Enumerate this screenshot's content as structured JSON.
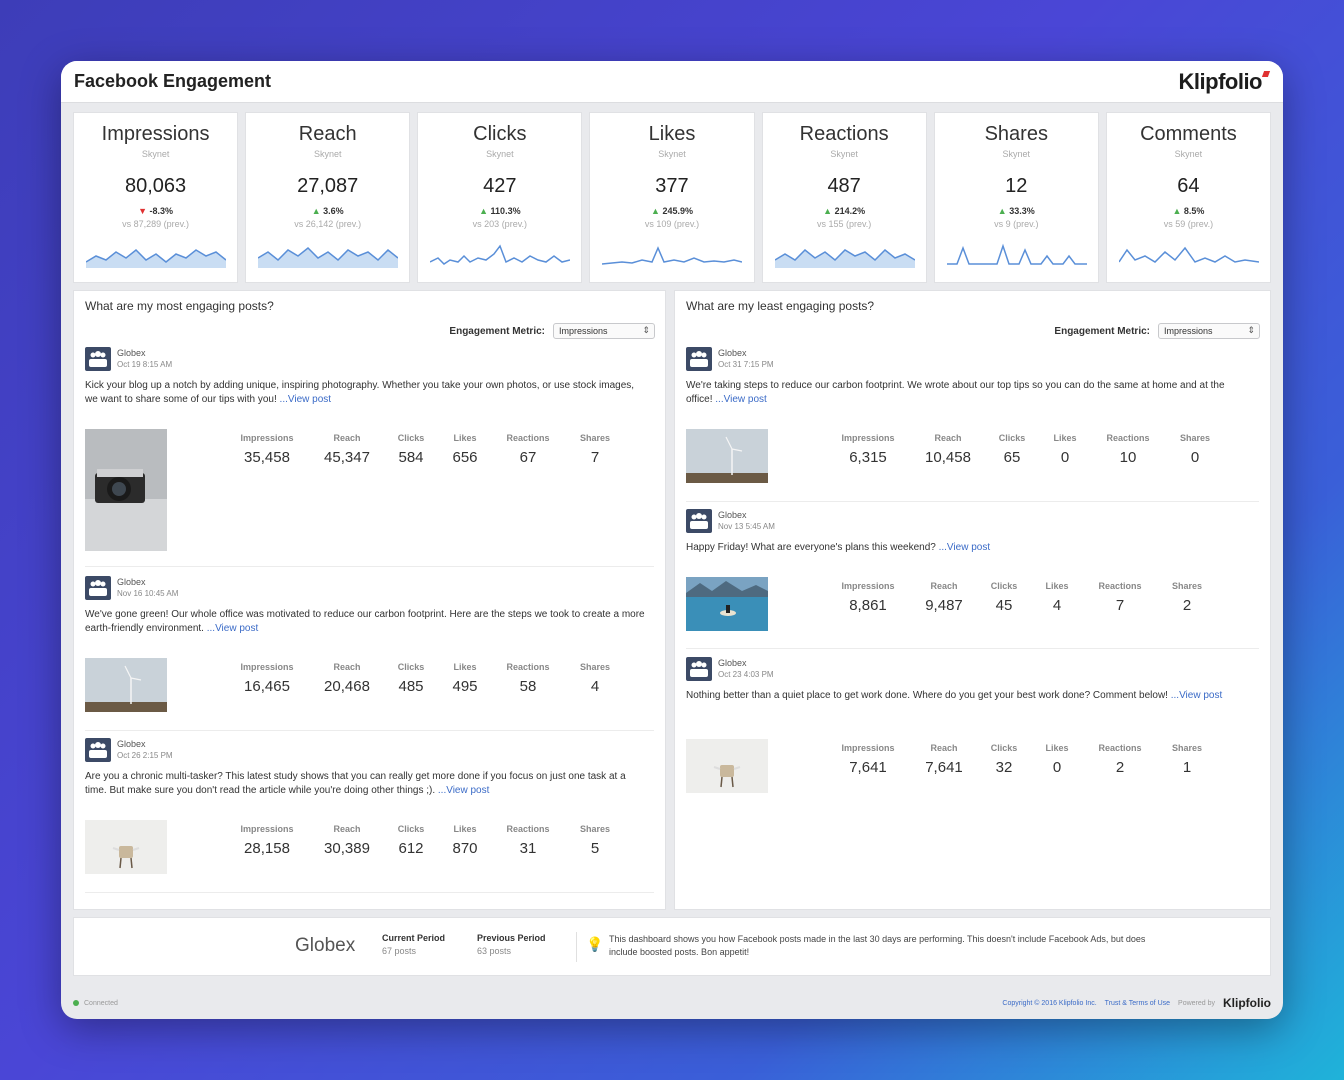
{
  "header": {
    "title": "Facebook Engagement",
    "brand": "Klipfolio"
  },
  "kpis": [
    {
      "name": "Impressions",
      "source": "Skynet",
      "value": "80,063",
      "change": "-8.3%",
      "direction": "down",
      "prev": "vs 87,289 (prev.)"
    },
    {
      "name": "Reach",
      "source": "Skynet",
      "value": "27,087",
      "change": "3.6%",
      "direction": "up",
      "prev": "vs 26,142 (prev.)"
    },
    {
      "name": "Clicks",
      "source": "Skynet",
      "value": "427",
      "change": "110.3%",
      "direction": "up",
      "prev": "vs 203 (prev.)"
    },
    {
      "name": "Likes",
      "source": "Skynet",
      "value": "377",
      "change": "245.9%",
      "direction": "up",
      "prev": "vs 109 (prev.)"
    },
    {
      "name": "Reactions",
      "source": "Skynet",
      "value": "487",
      "change": "214.2%",
      "direction": "up",
      "prev": "vs 155 (prev.)"
    },
    {
      "name": "Shares",
      "source": "Skynet",
      "value": "12",
      "change": "33.3%",
      "direction": "up",
      "prev": "vs 9 (prev.)"
    },
    {
      "name": "Comments",
      "source": "Skynet",
      "value": "64",
      "change": "8.5%",
      "direction": "up",
      "prev": "vs 59 (prev.)"
    }
  ],
  "most": {
    "title": "What are my most engaging posts?",
    "metric_label": "Engagement Metric:",
    "metric_value": "Impressions",
    "stat_labels": [
      "Impressions",
      "Reach",
      "Clicks",
      "Likes",
      "Reactions",
      "Shares"
    ],
    "posts": [
      {
        "author": "Globex",
        "date": "Oct 19 8:15 AM",
        "text": "Kick your blog up a notch by adding unique, inspiring photography. Whether you take your own photos, or use stock images, we want to share some of our tips with you! ",
        "link": "...View post",
        "stats": [
          "35,458",
          "45,347",
          "584",
          "656",
          "67",
          "7"
        ]
      },
      {
        "author": "Globex",
        "date": "Nov 16 10:45 AM",
        "text": "We've gone green! Our whole office was motivated to reduce our carbon footprint. Here are the steps we took to create a more earth-friendly environment. ",
        "link": "...View post",
        "stats": [
          "16,465",
          "20,468",
          "485",
          "495",
          "58",
          "4"
        ]
      },
      {
        "author": "Globex",
        "date": "Oct 26 2:15 PM",
        "text": "Are you a chronic multi-tasker? This latest study shows that you can really get more done if you focus on just one task at a time. But make sure you don't read the article while you're doing other things ;). ",
        "link": "...View post",
        "stats": [
          "28,158",
          "30,389",
          "612",
          "870",
          "31",
          "5"
        ]
      }
    ]
  },
  "least": {
    "title": "What are my least engaging posts?",
    "metric_label": "Engagement Metric:",
    "metric_value": "Impressions",
    "stat_labels": [
      "Impressions",
      "Reach",
      "Clicks",
      "Likes",
      "Reactions",
      "Shares"
    ],
    "posts": [
      {
        "author": "Globex",
        "date": "Oct 31 7:15 PM",
        "text": "We're taking steps to reduce our carbon footprint. We wrote about our top tips so you can do the same at home and at the office! ",
        "link": "...View post",
        "stats": [
          "6,315",
          "10,458",
          "65",
          "0",
          "10",
          "0"
        ]
      },
      {
        "author": "Globex",
        "date": "Nov 13 5:45 AM",
        "text": "Happy Friday! What are everyone's plans this weekend? ",
        "link": "...View post",
        "stats": [
          "8,861",
          "9,487",
          "45",
          "4",
          "7",
          "2"
        ]
      },
      {
        "author": "Globex",
        "date": "Oct 23 4:03 PM",
        "text": "Nothing better than a quiet place to get work done. Where do you get your best work done? Comment below! ",
        "link": "...View post",
        "stats": [
          "7,641",
          "7,641",
          "32",
          "0",
          "2",
          "1"
        ]
      }
    ]
  },
  "footer": {
    "company": "Globex",
    "current_label": "Current Period",
    "current_value": "67 posts",
    "previous_label": "Previous Period",
    "previous_value": "63 posts",
    "note": "This dashboard shows you how Facebook posts made in the last 30 days are performing. This doesn't include Facebook Ads, but does include boosted posts. Bon appetit!"
  },
  "status": {
    "connection": "Connected",
    "copyright": "Copyright © 2016 Klipfolio Inc.",
    "terms": "Trust & Terms of Use",
    "powered": "Powered by",
    "brand": "Klipfolio"
  },
  "colors": {
    "sparkline": "#5a8fd8",
    "sparkfill": "#c9ddf3",
    "up": "#4caf50",
    "down": "#e03131",
    "link": "#3b6bc7"
  }
}
